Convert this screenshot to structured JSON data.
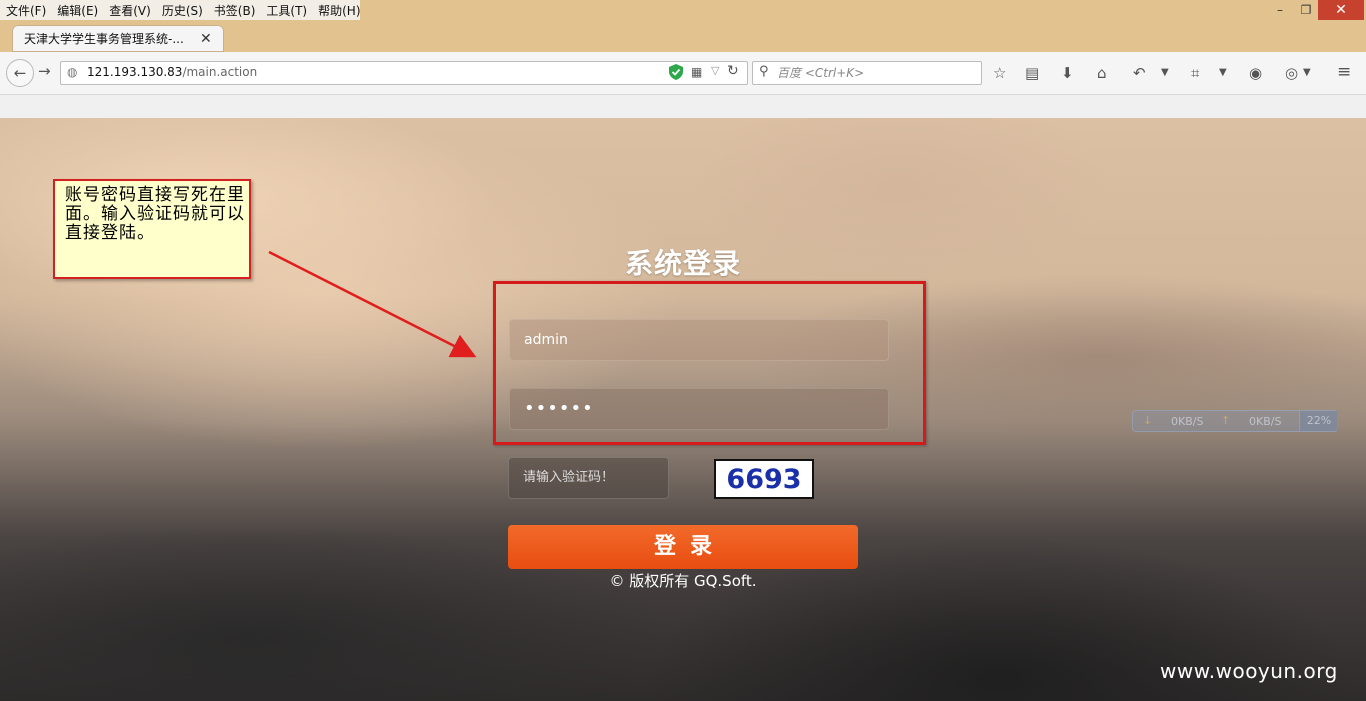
{
  "menu": {
    "items": [
      "文件(F)",
      "编辑(E)",
      "查看(V)",
      "历史(S)",
      "书签(B)",
      "工具(T)",
      "帮助(H)"
    ]
  },
  "window_controls": {
    "minimize": "–",
    "maximize": "❐",
    "close": "✕"
  },
  "tab": {
    "title": "天津大学学生事务管理系统-...",
    "close": "✕",
    "new_tab": "+"
  },
  "navbar": {
    "url_host": "121.193.130.83",
    "url_path": "/main.action",
    "search_placeholder": "百度 <Ctrl+K>"
  },
  "annotation": {
    "text": "账号密码直接写死在里面。输入验证码就可以直接登陆。",
    "border_color": "#d42020"
  },
  "login": {
    "title": "系统登录",
    "username_value": "admin",
    "password_value": "••••••",
    "captcha_placeholder": "请输入验证码！",
    "captcha_code": "6693",
    "submit_label": "登录",
    "copyright": "© 版权所有 GQ.Soft."
  },
  "speed_widget": {
    "down": "0KB/S",
    "up": "0KB/S",
    "percent": "22%"
  },
  "watermark": "www.wooyun.org",
  "colors": {
    "accent_button": "#e84d10",
    "highlight": "#d41a1a",
    "titlebar": "#e2c38f"
  }
}
